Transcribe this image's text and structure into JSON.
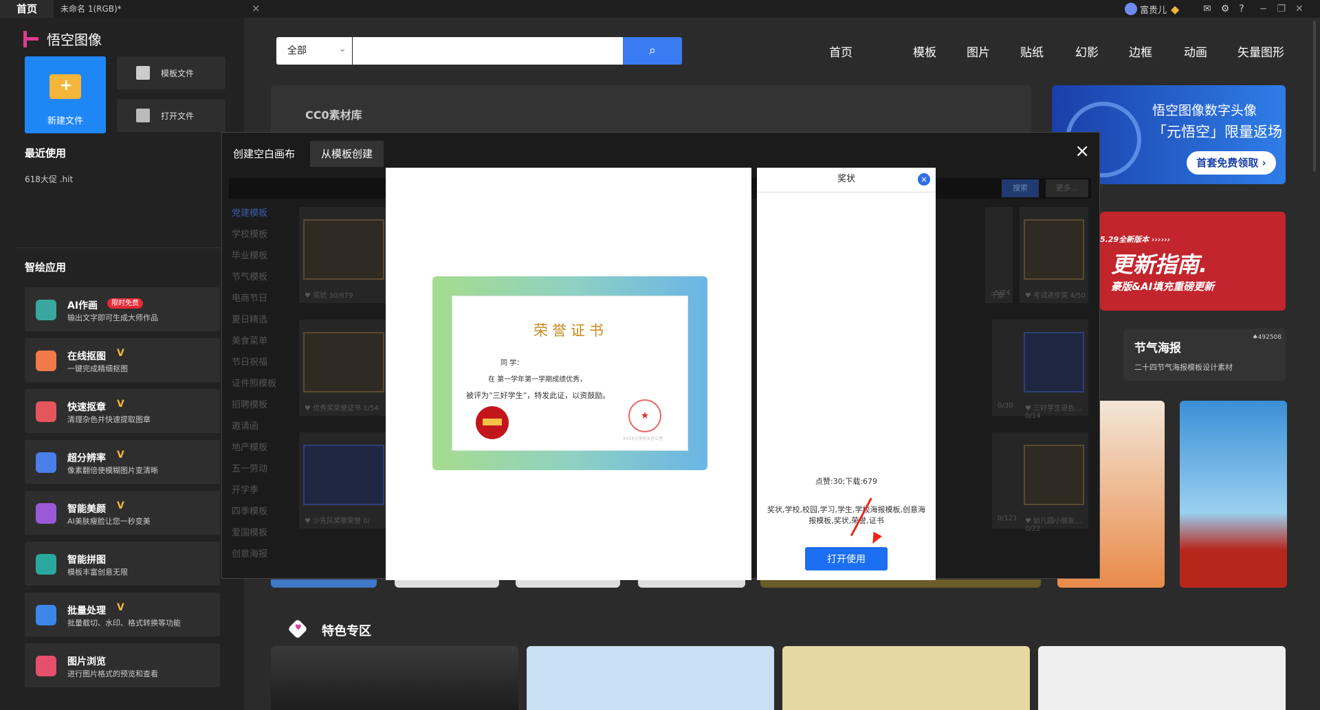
{
  "titlebar": {
    "home_tab": "首页",
    "doc_tab": "未命名 1(RGB)*",
    "close": "×",
    "username": "富贵儿"
  },
  "sidebar": {
    "logo": "悟空图像",
    "new_file": "新建文件",
    "template_file": "模板文件",
    "open_file": "打开文件",
    "recent_title": "最近使用",
    "recent_items": [
      "618大促 .hit"
    ],
    "apps_title": "智绘应用",
    "apps": [
      {
        "title": "AI作画",
        "sub": "输出文字即可生成大师作品",
        "badge": "限时免费",
        "color": "#3aa6a0"
      },
      {
        "title": "在线抠图",
        "sub": "一键完成精细抠图",
        "color": "#f07a4a"
      },
      {
        "title": "快速抠章",
        "sub": "清理杂色并快速提取图章",
        "color": "#e5555c"
      },
      {
        "title": "超分辨率",
        "sub": "像素翻倍使模糊图片变清晰",
        "color": "#4a7ee8"
      },
      {
        "title": "智能美颜",
        "sub": "AI美肤瘦脸让您一秒变美",
        "color": "#9a5ad8"
      },
      {
        "title": "智能拼图",
        "sub": "模板丰富创意无限",
        "color": "#2aa8a0"
      },
      {
        "title": "批量处理",
        "sub": "批量截切、水印、格式转换等功能",
        "color": "#3b86e8"
      },
      {
        "title": "图片浏览",
        "sub": "进行图片格式的预览和查看",
        "color": "#e5506a"
      }
    ]
  },
  "search": {
    "category": "全部",
    "placeholder": "",
    "button_icon": "search-icon"
  },
  "nav": [
    "首页",
    "模板",
    "图片",
    "贴纸",
    "幻影",
    "边框",
    "动画",
    "矢量图形"
  ],
  "banners": {
    "cc0_label": "CC0素材库",
    "promo1_line1": "悟空图像数字头像",
    "promo1_line2": "「元悟空」限量返场",
    "promo1_button": "首套免费领取 ›",
    "promo2_tag": "5.29全新版本 ››››››",
    "promo2_title": "更新指南.",
    "promo2_sub": "豪版&AI填充重磅更新",
    "jieqi_title": "节气海报",
    "jieqi_sub": "二十四节气海报模板设计素材",
    "jieqi_count": "492508"
  },
  "featured": {
    "title": "特色专区"
  },
  "dialog": {
    "tab_blank": "创建空白画布",
    "tab_template": "从模板创建",
    "close": "×",
    "dim_search_btn": "搜索",
    "dim_more_btn": "更多...",
    "categories": [
      "党建模板",
      "学校模板",
      "毕业模板",
      "节气模板",
      "电商节日",
      "夏日精选",
      "美食菜单",
      "节日祝福",
      "证件照模板",
      "招聘模板",
      "邀请函",
      "地产模板",
      "五一劳动",
      "开学季",
      "四季模板",
      "爱国模板",
      "创意海报"
    ],
    "cards": [
      {
        "label": "奖状",
        "count": "30/679"
      },
      {
        "label": "干部",
        "count": "5/24"
      },
      {
        "label": "考试进步奖",
        "count": "4/50"
      },
      {
        "label": "优秀奖荣誉证书",
        "count": "1/54"
      },
      {
        "label": "优秀…",
        "count": "0/30"
      },
      {
        "label": "三好学生退色…",
        "count": "0/14"
      },
      {
        "label": "少先队奖章荣誉",
        "count": "0/"
      },
      {
        "label": "荣誉…",
        "count": "0/121"
      },
      {
        "label": "幼儿园小朋友…",
        "count": "0/22"
      }
    ]
  },
  "certificate": {
    "title": "荣誉证书",
    "line1": "同 学：",
    "line2": "在                    第一学年第一学期成绩优秀，",
    "line3": "被评为“三好学生”，特发此证，以资鼓励。",
    "stamp_note": "XXXX小学校长办公室",
    "seal_text": "荣誉证"
  },
  "info_panel": {
    "title": "奖状",
    "close": "×",
    "stats": "点赞:30;下载:679",
    "tags": "奖状,学校,校园,学习,学生,学校海报模板,创意海报模板,奖状,荣誉,证书",
    "open_button": "打开使用"
  },
  "colors": {
    "accent": "#1c6ff0",
    "brand": "#e03b8f",
    "bg": "#2b2b2b"
  }
}
